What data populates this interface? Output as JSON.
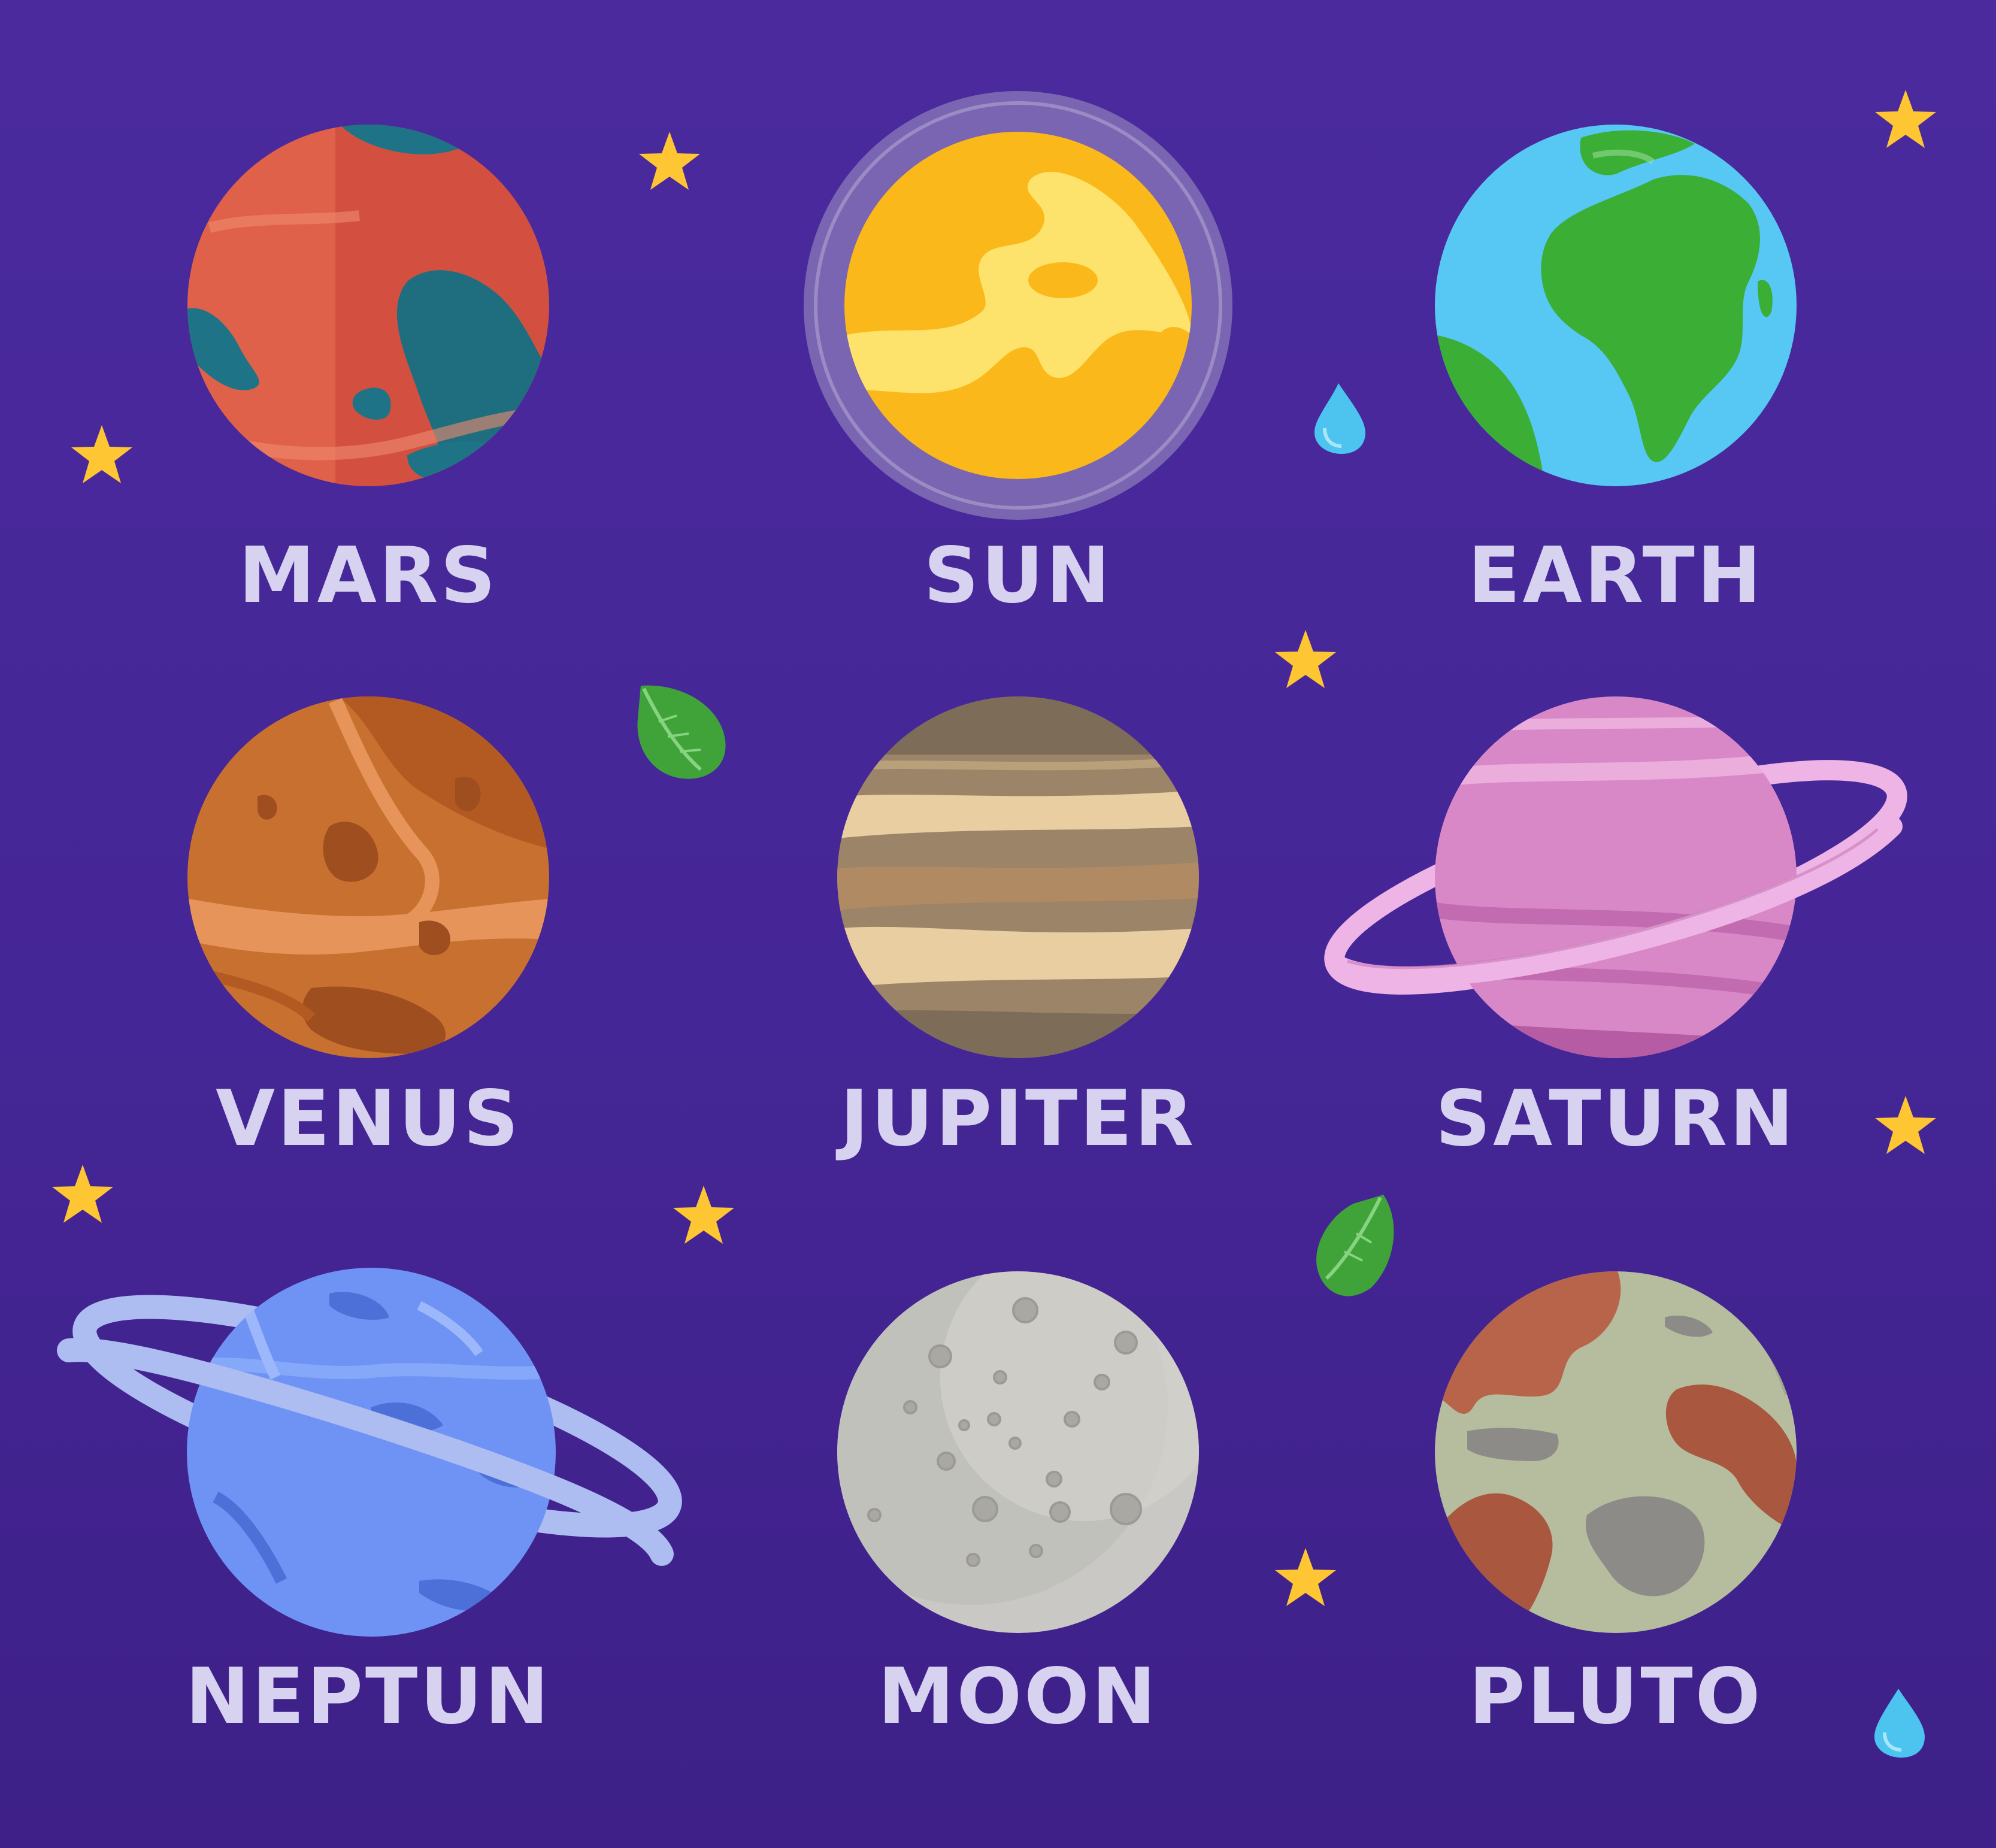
{
  "colors": {
    "background": "#45289a",
    "label": "#d6d2ef",
    "star": "#ffc633"
  },
  "planets": [
    {
      "name": "MARS",
      "icon": "mars-icon"
    },
    {
      "name": "SUN",
      "icon": "sun-icon"
    },
    {
      "name": "EARTH",
      "icon": "earth-icon"
    },
    {
      "name": "VENUS",
      "icon": "venus-icon"
    },
    {
      "name": "JUPITER",
      "icon": "jupiter-icon"
    },
    {
      "name": "SATURN",
      "icon": "saturn-icon"
    },
    {
      "name": "NEPTUN",
      "icon": "neptune-icon"
    },
    {
      "name": "MOON",
      "icon": "moon-icon"
    },
    {
      "name": "PLUTO",
      "icon": "pluto-icon"
    }
  ],
  "decorations": [
    "star-icon",
    "water-drop-icon",
    "leaf-icon"
  ]
}
